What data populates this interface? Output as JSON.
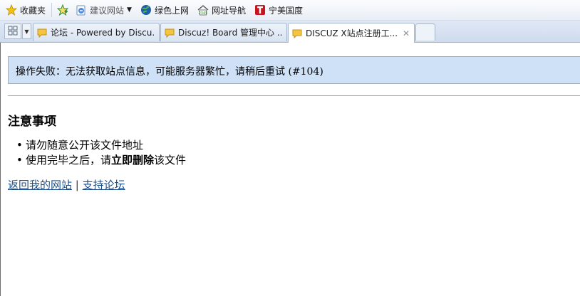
{
  "favorites_bar": {
    "items": [
      {
        "label": "收藏夹",
        "icon": "star-icon"
      },
      {
        "label": "建议网站",
        "icon": "suggested-sites-icon"
      },
      {
        "label": "绿色上网",
        "icon": "globe-icon"
      },
      {
        "label": "网址导航",
        "icon": "nav-house-icon"
      },
      {
        "label": "宁美国度",
        "icon": "t-logo-icon"
      }
    ]
  },
  "tabs": [
    {
      "title": "论坛 - Powered by Discu...",
      "active": false
    },
    {
      "title": "Discuz! Board 管理中心 ...",
      "active": false
    },
    {
      "title": "DISCUZ X站点注册工...",
      "active": true
    }
  ],
  "page": {
    "error_message": "操作失败：无法获取站点信息，可能服务器繁忙，请稍后重试 (#104)",
    "notice_heading": "注意事项",
    "notes": {
      "item1": "请勿随意公开该文件地址",
      "item2_prefix": "使用完毕之后，请",
      "item2_bold": "立即删除",
      "item2_suffix": "该文件"
    },
    "links": {
      "back": "返回我的网站",
      "separator": "|",
      "support": "支持论坛"
    }
  },
  "colors": {
    "alert_background": "#cfe1f7",
    "alert_border": "#8faed6",
    "link": "#1a4f8c"
  }
}
